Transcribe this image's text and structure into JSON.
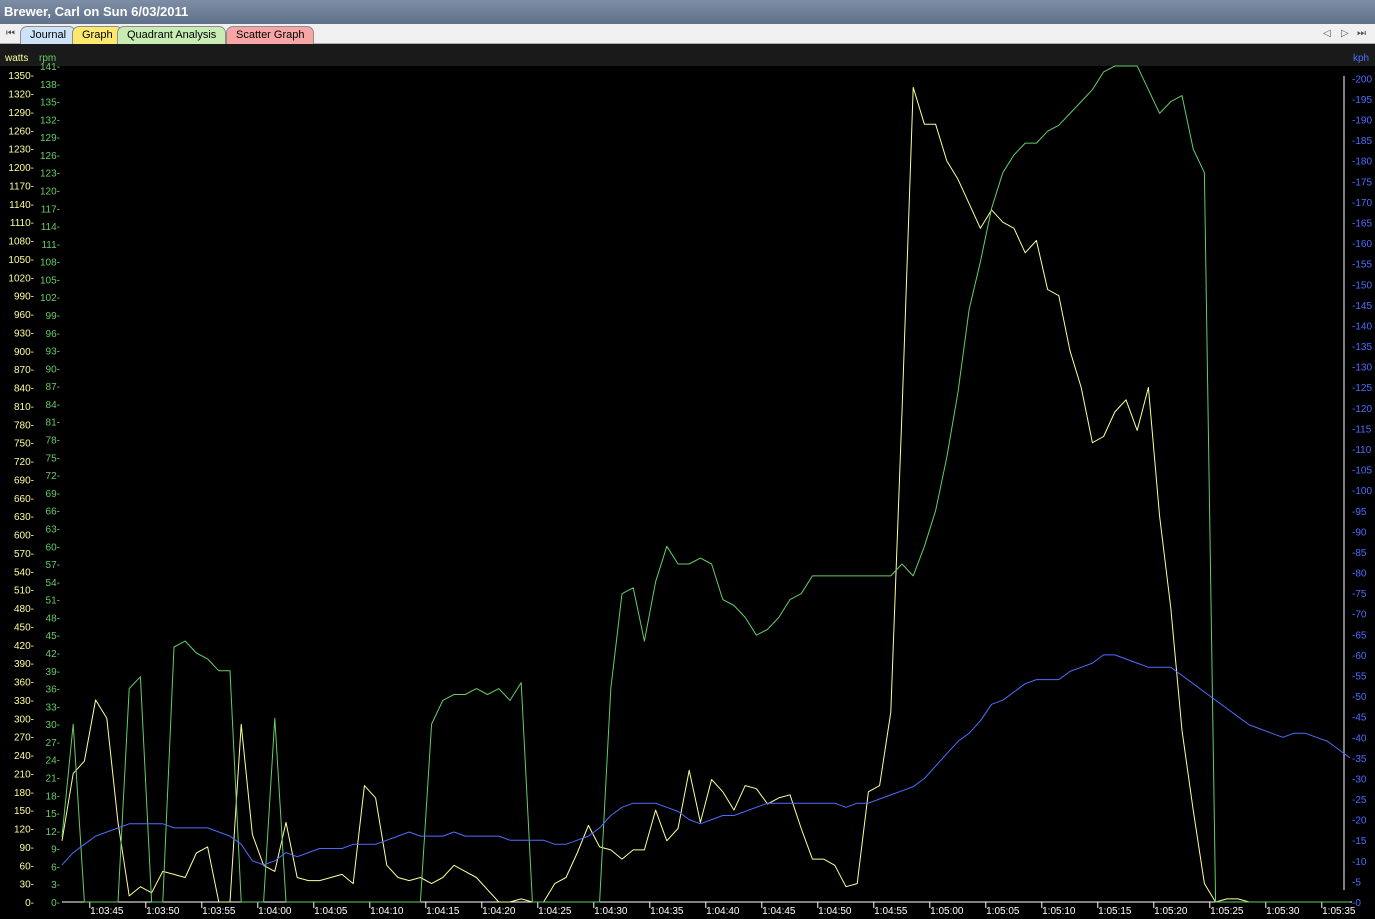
{
  "window": {
    "title": "Brewer, Carl on Sun 6/03/2011"
  },
  "tabs": [
    {
      "label": "Journal",
      "color": "#cfe3f8",
      "active": true
    },
    {
      "label": "Graph",
      "color": "#fde96f"
    },
    {
      "label": "Quadrant Analysis",
      "color": "#c8ecb4"
    },
    {
      "label": "Scatter Graph",
      "color": "#f7a5a5"
    }
  ],
  "nav": {
    "first": "⏮",
    "prev": "◁",
    "next": "▷",
    "last": "⏭"
  },
  "colors": {
    "background": "#000000",
    "watts": "#ffff99",
    "rpm": "#66cc66",
    "kph": "#4d6dff"
  },
  "chart_data": {
    "type": "line",
    "title": "",
    "xlabel": "",
    "x": [
      "1:03:41",
      "1:03:42",
      "1:03:43",
      "1:03:44",
      "1:03:45",
      "1:03:46",
      "1:03:47",
      "1:03:48",
      "1:03:49",
      "1:03:50",
      "1:03:51",
      "1:03:52",
      "1:03:53",
      "1:03:54",
      "1:03:55",
      "1:03:56",
      "1:03:57",
      "1:03:58",
      "1:03:59",
      "1:04:00",
      "1:04:01",
      "1:04:02",
      "1:04:03",
      "1:04:04",
      "1:04:05",
      "1:04:06",
      "1:04:07",
      "1:04:08",
      "1:04:09",
      "1:04:10",
      "1:04:11",
      "1:04:12",
      "1:04:13",
      "1:04:14",
      "1:04:15",
      "1:04:16",
      "1:04:17",
      "1:04:18",
      "1:04:19",
      "1:04:20",
      "1:04:21",
      "1:04:22",
      "1:04:23",
      "1:04:24",
      "1:04:25",
      "1:04:26",
      "1:04:27",
      "1:04:28",
      "1:04:29",
      "1:04:30",
      "1:04:31",
      "1:04:32",
      "1:04:33",
      "1:04:34",
      "1:04:35",
      "1:04:36",
      "1:04:37",
      "1:04:38",
      "1:04:39",
      "1:04:40",
      "1:04:41",
      "1:04:42",
      "1:04:43",
      "1:04:44",
      "1:04:45",
      "1:04:46",
      "1:04:47",
      "1:04:48",
      "1:04:49",
      "1:04:50",
      "1:04:51",
      "1:04:52",
      "1:04:53",
      "1:04:54",
      "1:04:55",
      "1:04:56",
      "1:04:57",
      "1:04:58",
      "1:04:59",
      "1:05:00",
      "1:05:01",
      "1:05:02",
      "1:05:03",
      "1:05:04",
      "1:05:05",
      "1:05:06",
      "1:05:07",
      "1:05:08",
      "1:05:09",
      "1:05:10",
      "1:05:11",
      "1:05:12",
      "1:05:13",
      "1:05:14",
      "1:05:15",
      "1:05:16",
      "1:05:17",
      "1:05:18",
      "1:05:19",
      "1:05:20",
      "1:05:21",
      "1:05:22",
      "1:05:23",
      "1:05:24",
      "1:05:25",
      "1:05:26",
      "1:05:27",
      "1:05:28",
      "1:05:29",
      "1:05:30",
      "1:05:31",
      "1:05:32",
      "1:05:33",
      "1:05:34",
      "1:05:35",
      "1:05:36"
    ],
    "xticks": [
      "1:03:45",
      "1:03:50",
      "1:03:55",
      "1:04:00",
      "1:04:05",
      "1:04:10",
      "1:04:15",
      "1:04:20",
      "1:04:25",
      "1:04:30",
      "1:04:35",
      "1:04:40",
      "1:04:45",
      "1:04:50",
      "1:04:55",
      "1:05:00",
      "1:05:05",
      "1:05:10",
      "1:05:15",
      "1:05:20",
      "1:05:25",
      "1:05:30",
      "1:05:35"
    ],
    "axes": {
      "watts": {
        "label": "watts",
        "min": 0,
        "max": 1365,
        "step": 30,
        "side": "left"
      },
      "rpm": {
        "label": "rpm",
        "min": 0,
        "max": 141,
        "step": 3,
        "side": "left"
      },
      "kph": {
        "label": "kph",
        "min": 0,
        "max": 203,
        "step": 5,
        "side": "right"
      }
    },
    "series": [
      {
        "name": "watts",
        "axis": "watts",
        "values": [
          100,
          210,
          230,
          330,
          300,
          130,
          10,
          25,
          15,
          50,
          45,
          40,
          80,
          90,
          0,
          0,
          290,
          110,
          60,
          50,
          130,
          40,
          35,
          35,
          40,
          45,
          30,
          190,
          170,
          60,
          40,
          35,
          40,
          30,
          40,
          60,
          50,
          40,
          20,
          0,
          0,
          5,
          0,
          0,
          30,
          40,
          80,
          125,
          90,
          85,
          70,
          85,
          85,
          150,
          100,
          120,
          215,
          130,
          200,
          180,
          150,
          190,
          185,
          160,
          170,
          175,
          120,
          70,
          70,
          60,
          25,
          30,
          180,
          190,
          310,
          800,
          1330,
          1270,
          1270,
          1210,
          1180,
          1140,
          1100,
          1130,
          1110,
          1100,
          1060,
          1080,
          1000,
          990,
          900,
          840,
          750,
          760,
          800,
          820,
          770,
          840,
          630,
          480,
          280,
          150,
          30,
          0,
          5,
          5,
          0,
          0,
          0,
          0,
          0,
          0,
          0,
          0,
          0,
          0
        ]
      },
      {
        "name": "rpm",
        "axis": "rpm",
        "values": [
          11,
          30,
          0,
          0,
          0,
          0,
          36,
          38,
          0,
          0,
          43,
          44,
          42,
          41,
          39,
          39,
          0,
          0,
          0,
          31,
          0,
          0,
          0,
          0,
          0,
          0,
          0,
          0,
          0,
          0,
          0,
          0,
          0,
          30,
          34,
          35,
          35,
          36,
          35,
          36,
          34,
          37,
          0,
          0,
          0,
          0,
          0,
          0,
          0,
          36,
          52,
          53,
          44,
          54,
          60,
          57,
          57,
          58,
          57,
          51,
          50,
          48,
          45,
          46,
          48,
          51,
          52,
          55,
          55,
          55,
          55,
          55,
          55,
          55,
          55,
          57,
          55,
          60,
          66,
          75,
          86,
          100,
          108,
          117,
          123,
          126,
          128,
          128,
          130,
          131,
          133,
          135,
          137,
          140,
          141,
          141,
          141,
          137,
          133,
          135,
          136,
          127,
          123,
          0,
          0,
          0,
          0,
          0,
          0,
          0,
          0,
          0,
          0,
          0,
          0,
          0
        ]
      },
      {
        "name": "kph",
        "axis": "kph",
        "values": [
          9,
          12,
          14,
          16,
          17,
          18,
          19,
          19,
          19,
          19,
          18,
          18,
          18,
          18,
          17,
          16,
          14,
          10,
          9,
          10,
          12,
          11,
          12,
          13,
          13,
          13,
          14,
          14,
          14,
          15,
          16,
          17,
          16,
          16,
          16,
          17,
          16,
          16,
          16,
          16,
          15,
          15,
          15,
          15,
          14,
          14,
          15,
          16,
          18,
          21,
          23,
          24,
          24,
          24,
          23,
          22,
          20,
          19,
          20,
          21,
          21,
          22,
          23,
          24,
          24,
          24,
          24,
          24,
          24,
          24,
          23,
          24,
          24,
          25,
          26,
          27,
          28,
          30,
          33,
          36,
          39,
          41,
          44,
          48,
          49,
          51,
          53,
          54,
          54,
          54,
          56,
          57,
          58,
          60,
          60,
          59,
          58,
          57,
          57,
          57,
          55,
          53,
          51,
          49,
          47,
          45,
          43,
          42,
          41,
          40,
          41,
          41,
          40,
          39,
          37,
          35
        ]
      }
    ],
    "grid": false,
    "legend": "none"
  }
}
